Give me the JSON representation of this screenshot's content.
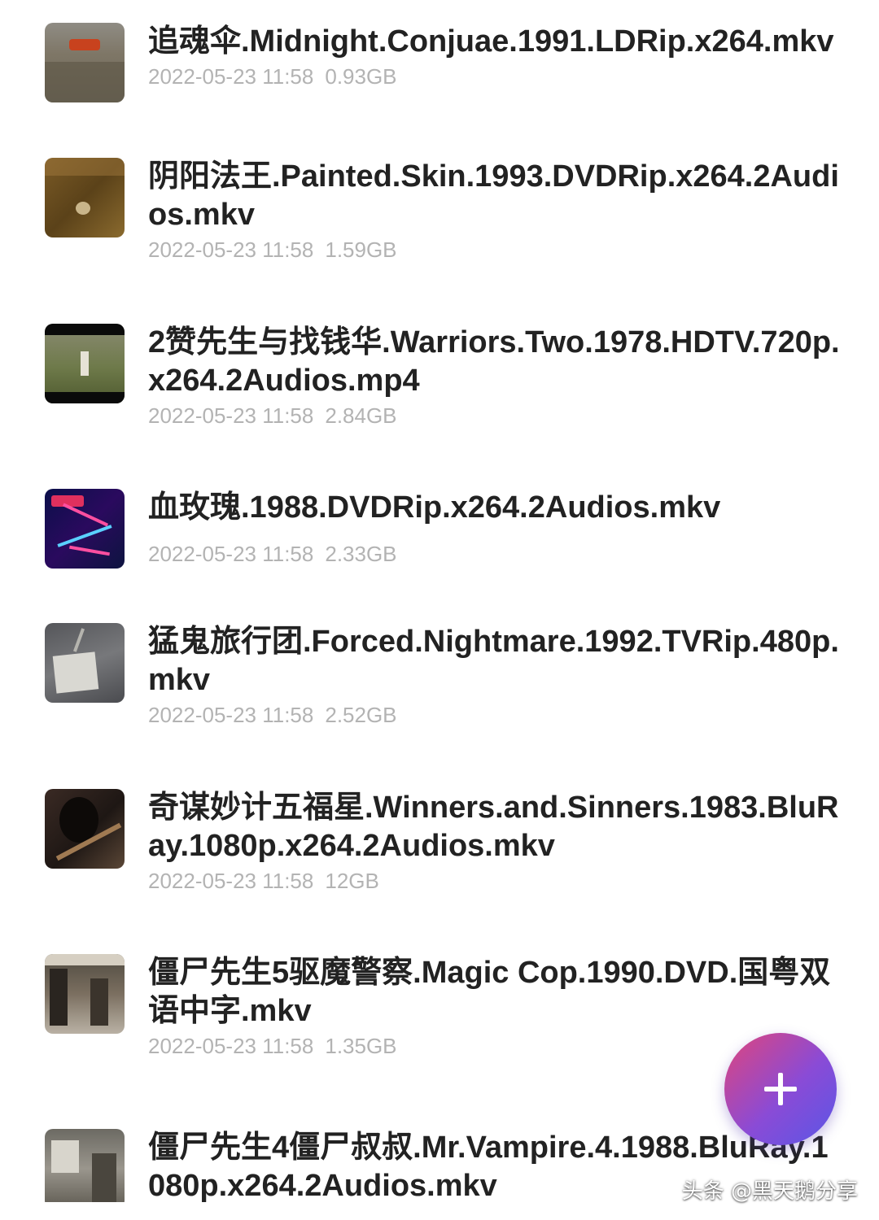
{
  "files": [
    {
      "name": "追魂伞.Midnight.Conjuae.1991.LDRip.x264.mkv",
      "date": "2022-05-23 11:58",
      "size": "0.93GB"
    },
    {
      "name": "阴阳法王.Painted.Skin.1993.DVDRip.x264.2Audios.mkv",
      "date": "2022-05-23 11:58",
      "size": "1.59GB"
    },
    {
      "name": "2赞先生与找钱华.Warriors.Two.1978.HDTV.720p.x264.2Audios.mp4",
      "date": "2022-05-23 11:58",
      "size": "2.84GB"
    },
    {
      "name": "血玫瑰.1988.DVDRip.x264.2Audios.mkv",
      "date": "2022-05-23 11:58",
      "size": "2.33GB"
    },
    {
      "name": "猛鬼旅行团.Forced.Nightmare.1992.TVRip.480p.mkv",
      "date": "2022-05-23 11:58",
      "size": "2.52GB"
    },
    {
      "name": "奇谋妙计五福星.Winners.and.Sinners.1983.BluRay.1080p.x264.2Audios.mkv",
      "date": "2022-05-23 11:58",
      "size": "12GB"
    },
    {
      "name": "僵尸先生5驱魔警察.Magic Cop.1990.DVD.国粤双语中字.mkv",
      "date": "2022-05-23 11:58",
      "size": "1.35GB"
    },
    {
      "name": "僵尸先生4僵尸叔叔.Mr.Vampire.4.1988.BluRay.1080p.x264.2Audios.mkv",
      "date": "",
      "size": ""
    }
  ],
  "fab": {
    "icon": "plus-icon"
  },
  "watermark": "头条 @黑天鹅分享"
}
